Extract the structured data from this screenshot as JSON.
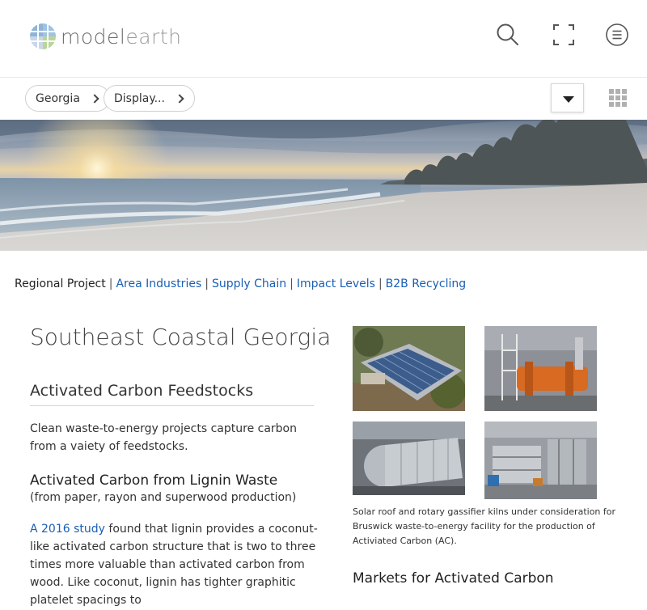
{
  "header": {
    "logo_primary": "model",
    "logo_secondary": "earth",
    "icons": [
      "search-icon",
      "fullscreen-icon",
      "menu-icon"
    ]
  },
  "breadcrumb": {
    "items": [
      {
        "label": "Georgia"
      },
      {
        "label": "Display..."
      }
    ]
  },
  "nav": {
    "current": "Regional Project",
    "separator": "|",
    "links": [
      "Area Industries",
      "Supply Chain",
      "Impact Levels",
      "B2B Recycling"
    ]
  },
  "main": {
    "title": "Southeast Coastal Georgia",
    "section_title": "Activated Carbon Feedstocks",
    "intro": "Clean waste-to-energy projects capture carbon from a vaiety of feedstocks.",
    "lignin_title": "Activated Carbon from Lignin Waste",
    "lignin_subtitle": "(from paper, rayon and superwood production)",
    "study_link": "A 2016 study",
    "study_text": " found that lignin provides a coconut-like activated carbon structure that is two to three times more valuable than activated carbon from wood. Like coconut, lignin has tighter graphitic platelet spacings to"
  },
  "aside": {
    "caption": "Solar roof and rotary gassifier kilns under consideration for Bruswick waste-to-energy facility for the production of Activiated Carbon (AC).",
    "markets_title": "Markets for Activated Carbon"
  },
  "colors": {
    "link": "#1a5fb4",
    "text": "#333333",
    "logo": "#6c6c6c"
  }
}
